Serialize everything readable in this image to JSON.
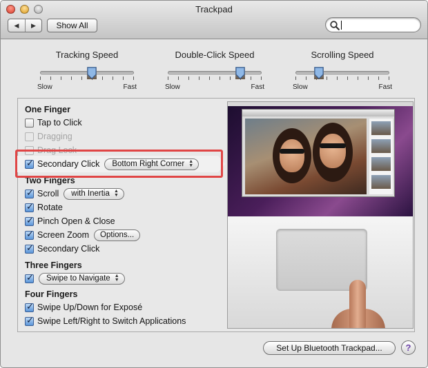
{
  "window": {
    "title": "Trackpad"
  },
  "toolbar": {
    "back_glyph": "◀",
    "forward_glyph": "▶",
    "show_all_label": "Show All",
    "search_value": "",
    "search_placeholder": ""
  },
  "speeds": [
    {
      "label": "Tracking Speed",
      "min_label": "Slow",
      "max_label": "Fast",
      "value": 0.55
    },
    {
      "label": "Double-Click Speed",
      "min_label": "Slow",
      "max_label": "Fast",
      "value": 0.77
    },
    {
      "label": "Scrolling Speed",
      "min_label": "Slow",
      "max_label": "Fast",
      "value": 0.25
    }
  ],
  "one_finger": {
    "heading": "One Finger",
    "tap_to_click": {
      "label": "Tap to Click",
      "checked": false
    },
    "dragging": {
      "label": "Dragging",
      "checked": false,
      "enabled": false
    },
    "drag_lock": {
      "label": "Drag Lock",
      "checked": false,
      "enabled": false
    },
    "secondary_click": {
      "label": "Secondary Click",
      "checked": true,
      "option": "Bottom Right Corner"
    }
  },
  "two_fingers": {
    "heading": "Two Fingers",
    "scroll": {
      "label": "Scroll",
      "checked": true,
      "option": "with Inertia"
    },
    "rotate": {
      "label": "Rotate",
      "checked": true
    },
    "pinch": {
      "label": "Pinch Open & Close",
      "checked": true
    },
    "screen_zoom": {
      "label": "Screen Zoom",
      "checked": true,
      "button": "Options..."
    },
    "secondary_click": {
      "label": "Secondary Click",
      "checked": true
    }
  },
  "three_fingers": {
    "heading": "Three Fingers",
    "swipe": {
      "checked": true,
      "option": "Swipe to Navigate"
    }
  },
  "four_fingers": {
    "heading": "Four Fingers",
    "expose": {
      "label": "Swipe Up/Down for Exposé",
      "checked": true
    },
    "switch_apps": {
      "label": "Swipe Left/Right to Switch Applications",
      "checked": true
    }
  },
  "footer": {
    "bluetooth_button": "Set Up Bluetooth Trackpad...",
    "help_glyph": "?"
  },
  "colors": {
    "highlight": "#e04545",
    "accent": "#5a95d8"
  }
}
